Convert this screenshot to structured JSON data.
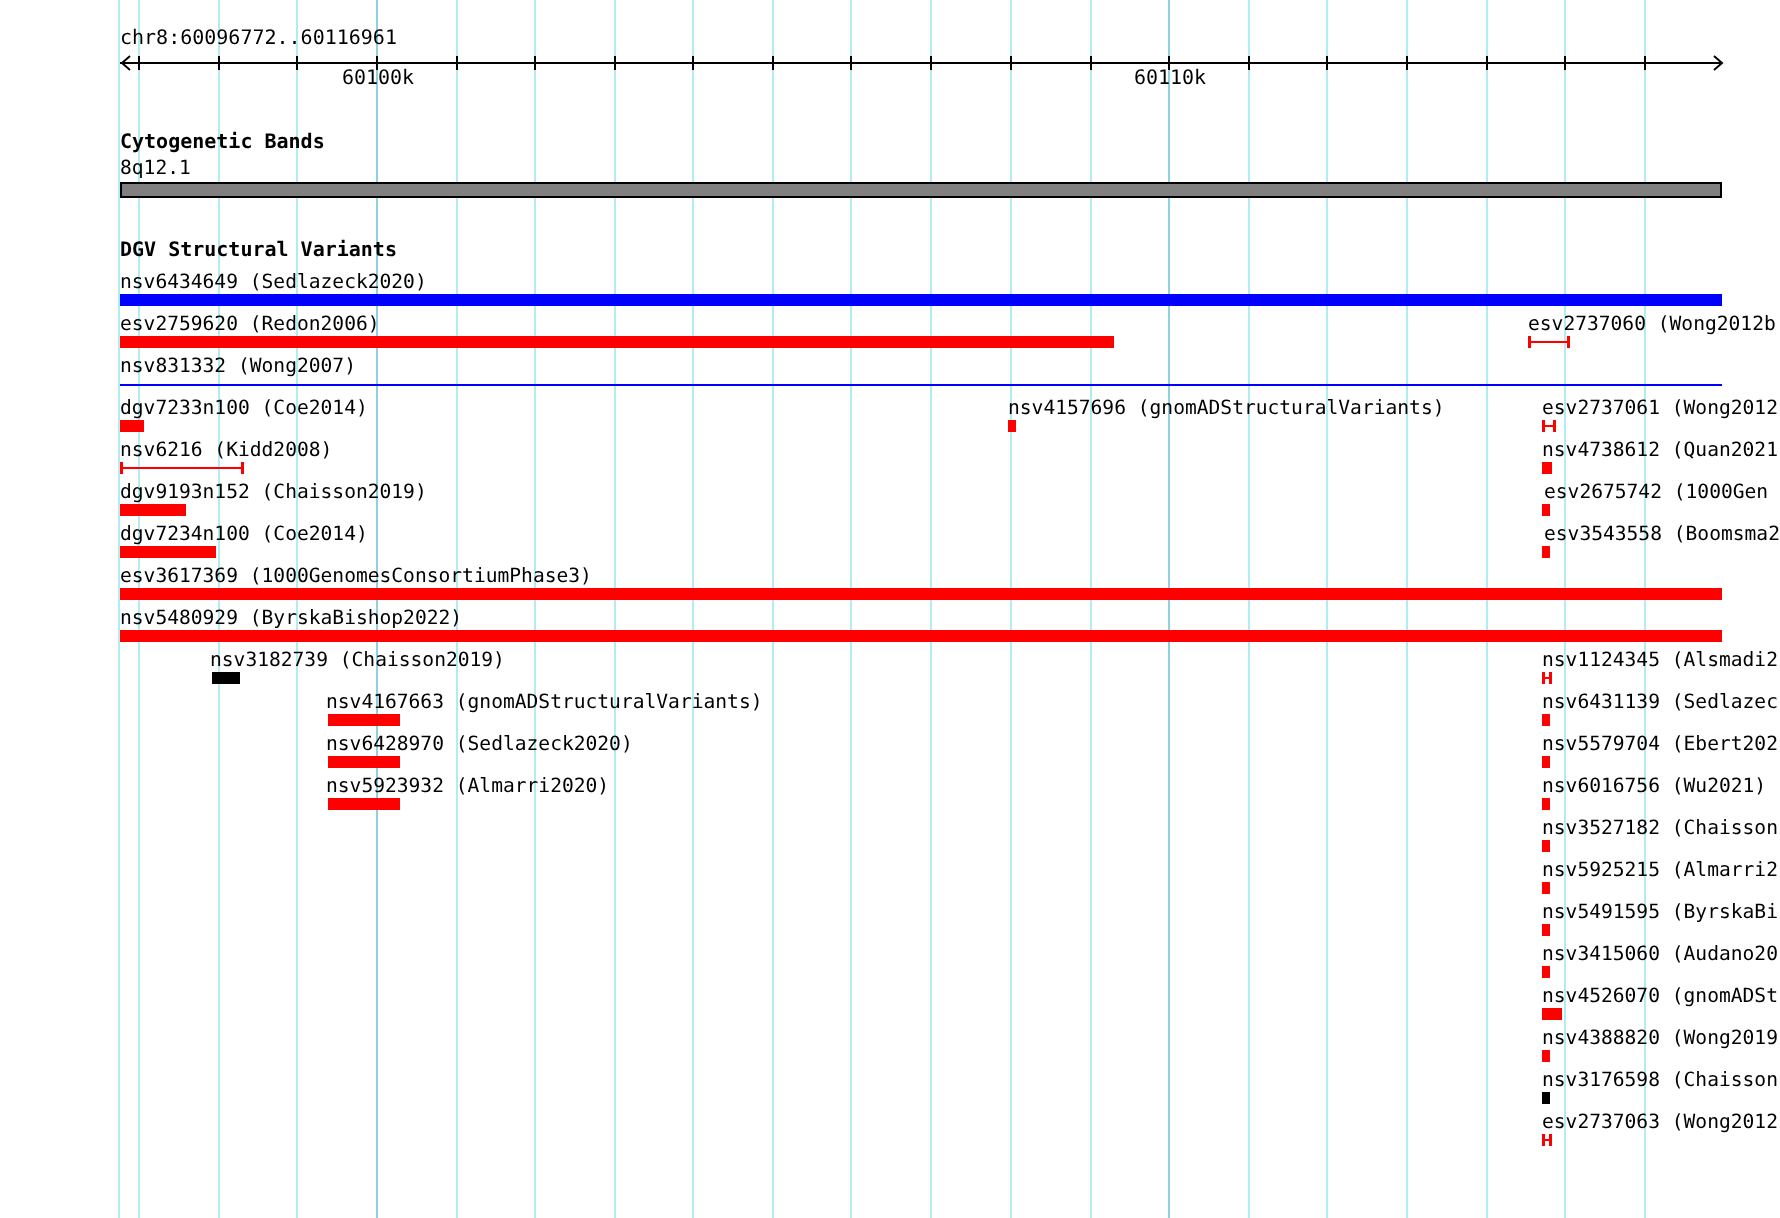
{
  "ruler": {
    "location": "chr8:60096772..60116961",
    "tick_labels": [
      "60100k",
      "60110k"
    ]
  },
  "tracks": [
    {
      "title": "Cytogenetic Bands",
      "features": [
        {
          "label": "8q12.1",
          "kind": "band",
          "color": "#808080"
        }
      ]
    },
    {
      "title": "DGV Structural Variants",
      "features": [
        {
          "label": "nsv6434649 (Sedlazeck2020)",
          "kind": "bar",
          "color": "#0000ff"
        },
        {
          "label": "esv2759620 (Redon2006)",
          "kind": "bar",
          "color": "#ff0000"
        },
        {
          "label": "esv2737060 (Wong2012b",
          "kind": "interval",
          "color": "#ff0000"
        },
        {
          "label": "nsv831332 (Wong2007)",
          "kind": "line",
          "color": "#0000ff"
        },
        {
          "label": "dgv7233n100 (Coe2014)",
          "kind": "bar",
          "color": "#ff0000"
        },
        {
          "label": "nsv4157696 (gnomADStructuralVariants)",
          "kind": "bar",
          "color": "#ff0000"
        },
        {
          "label": "esv2737061 (Wong2012",
          "kind": "interval",
          "color": "#ff0000"
        },
        {
          "label": "nsv6216 (Kidd2008)",
          "kind": "interval",
          "color": "#ff0000"
        },
        {
          "label": "nsv4738612 (Quan2021",
          "kind": "bar",
          "color": "#ff0000"
        },
        {
          "label": "dgv9193n152 (Chaisson2019)",
          "kind": "bar",
          "color": "#ff0000"
        },
        {
          "label": "esv2675742 (1000Gen",
          "kind": "bar",
          "color": "#ff0000"
        },
        {
          "label": "dgv7234n100 (Coe2014)",
          "kind": "bar",
          "color": "#ff0000"
        },
        {
          "label": "esv3543558 (Boomsma2",
          "kind": "bar",
          "color": "#ff0000"
        },
        {
          "label": "esv3617369 (1000GenomesConsortiumPhase3)",
          "kind": "bar",
          "color": "#ff0000"
        },
        {
          "label": "nsv5480929 (ByrskaBishop2022)",
          "kind": "bar",
          "color": "#ff0000"
        },
        {
          "label": "nsv3182739 (Chaisson2019)",
          "kind": "bar",
          "color": "#000000"
        },
        {
          "label": "nsv1124345 (Alsmadi2",
          "kind": "interval",
          "color": "#ff0000"
        },
        {
          "label": "nsv4167663 (gnomADStructuralVariants)",
          "kind": "bar",
          "color": "#ff0000"
        },
        {
          "label": "nsv6431139 (Sedlazec",
          "kind": "bar",
          "color": "#ff0000"
        },
        {
          "label": "nsv6428970 (Sedlazeck2020)",
          "kind": "bar",
          "color": "#ff0000"
        },
        {
          "label": "nsv5579704 (Ebert202",
          "kind": "bar",
          "color": "#ff0000"
        },
        {
          "label": "nsv5923932 (Almarri2020)",
          "kind": "bar",
          "color": "#ff0000"
        },
        {
          "label": "nsv6016756 (Wu2021)",
          "kind": "bar",
          "color": "#ff0000"
        },
        {
          "label": "nsv3527182 (Chaisson",
          "kind": "bar",
          "color": "#ff0000"
        },
        {
          "label": "nsv5925215 (Almarri2",
          "kind": "bar",
          "color": "#ff0000"
        },
        {
          "label": "nsv5491595 (ByrskaBi",
          "kind": "bar",
          "color": "#ff0000"
        },
        {
          "label": "nsv3415060 (Audano20",
          "kind": "bar",
          "color": "#ff0000"
        },
        {
          "label": "nsv4526070 (gnomADSt",
          "kind": "bar",
          "color": "#ff0000"
        },
        {
          "label": "nsv4388820 (Wong2019",
          "kind": "bar",
          "color": "#ff0000"
        },
        {
          "label": "nsv3176598 (Chaisson",
          "kind": "bar",
          "color": "#000000"
        },
        {
          "label": "esv2737063 (Wong2012",
          "kind": "interval",
          "color": "#ff0000"
        }
      ]
    }
  ]
}
